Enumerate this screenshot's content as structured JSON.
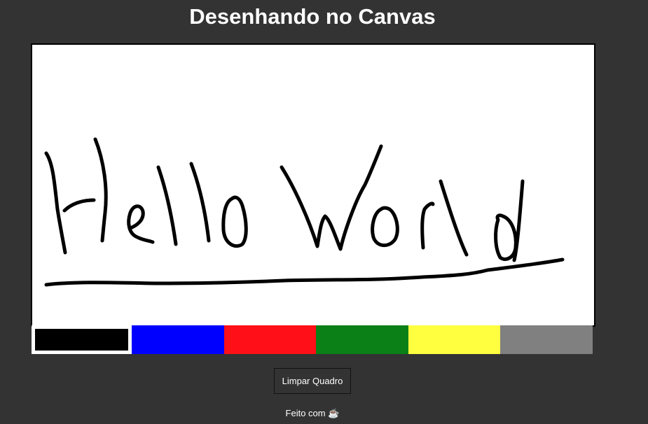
{
  "page": {
    "title": "Desenhando no Canvas"
  },
  "canvas": {
    "ink_color": "#000000",
    "background": "#ffffff"
  },
  "palette": {
    "colors": [
      {
        "name": "black",
        "hex": "#000000",
        "selected": true
      },
      {
        "name": "blue",
        "hex": "#0000ff",
        "selected": false
      },
      {
        "name": "red",
        "hex": "#ff0f17",
        "selected": false
      },
      {
        "name": "green",
        "hex": "#0b8016",
        "selected": false
      },
      {
        "name": "yellow",
        "hex": "#ffff3f",
        "selected": false
      },
      {
        "name": "gray",
        "hex": "#808080",
        "selected": false
      }
    ]
  },
  "toolbar": {
    "clear_label": "Limpar Quadro"
  },
  "footer": {
    "text_prefix": "Feito com",
    "icon": "coffee-icon",
    "glyph": "☕"
  }
}
